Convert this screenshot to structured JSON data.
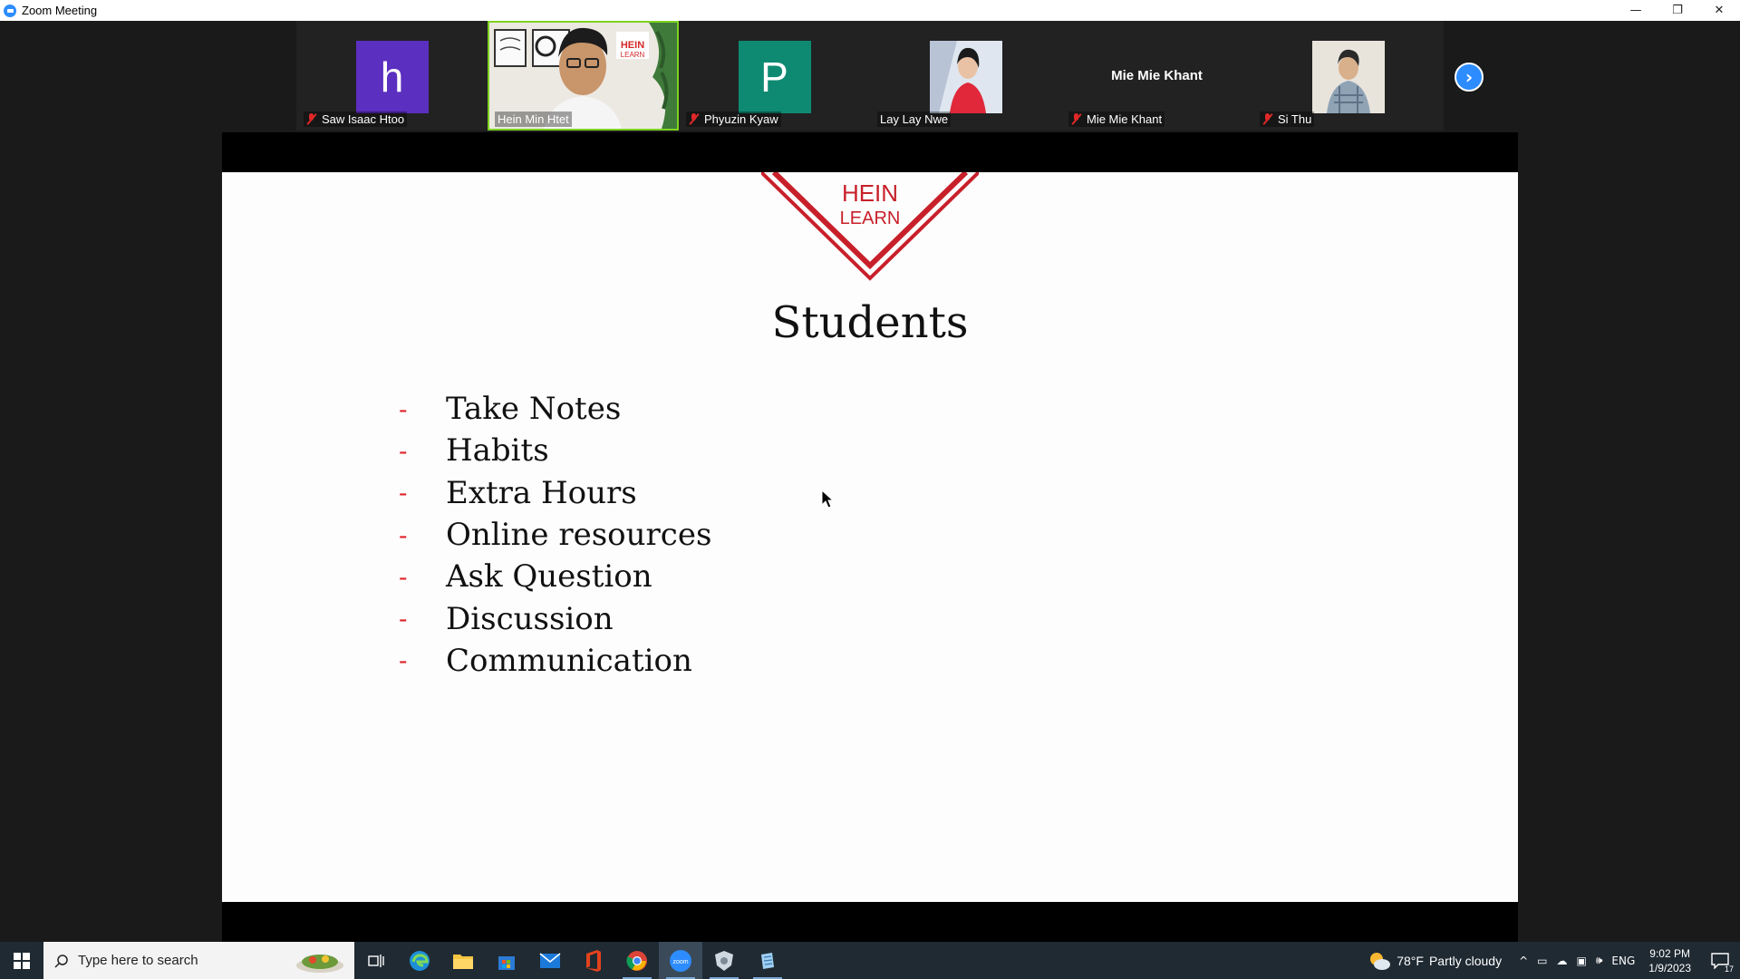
{
  "window": {
    "title": "Zoom Meeting",
    "minimize": "—",
    "restore": "❐",
    "close": "✕"
  },
  "participants": [
    {
      "name": "Saw Isaac Htoo",
      "avatar_letter": "h",
      "avatar_color": "#5b2fbf",
      "muted": true,
      "type": "letter"
    },
    {
      "name": "Hein Min Htet",
      "muted": false,
      "type": "video",
      "active": true
    },
    {
      "name": "Phyuzin Kyaw",
      "avatar_letter": "P",
      "avatar_color": "#0e8a72",
      "muted": true,
      "type": "letter"
    },
    {
      "name": "Lay Lay Nwe",
      "muted": false,
      "type": "photo"
    },
    {
      "name": "Mie Mie Khant",
      "display_text": "Mie Mie Khant",
      "muted": true,
      "type": "text"
    },
    {
      "name": "Si Thu",
      "muted": true,
      "type": "photo"
    }
  ],
  "strip_next": "›",
  "slide": {
    "logo_line1": "HEIN",
    "logo_line2": "LEARN",
    "title": "Students",
    "bullet_dash": "-",
    "bullets": [
      "Take Notes",
      "Habits",
      "Extra Hours",
      "Online resources",
      "Ask Question",
      "Discussion",
      "Communication"
    ]
  },
  "taskbar": {
    "search_placeholder": "Type here to search",
    "weather_temp": "78°F",
    "weather_desc": "Partly cloudy",
    "language": "ENG",
    "time": "9:02 PM",
    "date": "1/9/2023",
    "notification_count": "17"
  },
  "colors": {
    "accent_blue": "#2d8cff",
    "brand_red": "#e0242a",
    "active_speaker": "#7ed321"
  }
}
